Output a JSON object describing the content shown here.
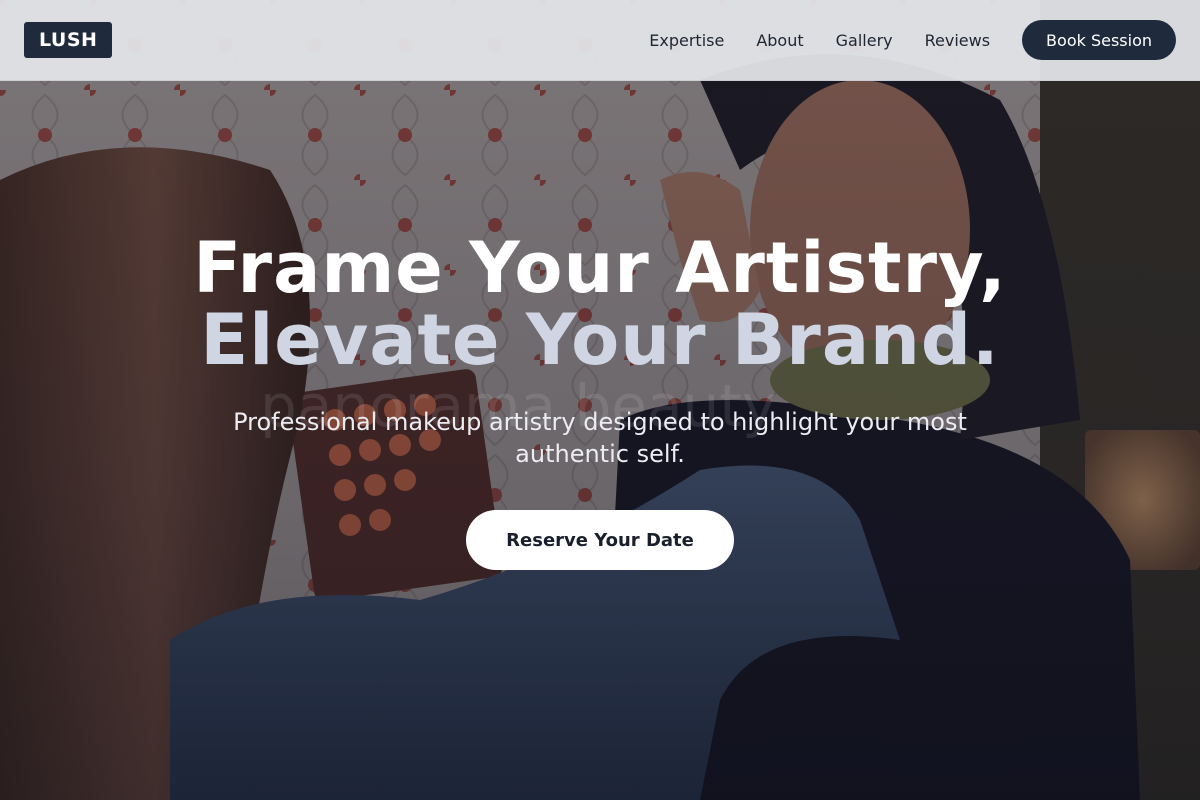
{
  "brand": {
    "logo_text": "LUSH"
  },
  "nav": {
    "links": [
      "Expertise",
      "About",
      "Gallery",
      "Reviews"
    ],
    "book_label": "Book Session"
  },
  "hero": {
    "headline_line1": "Frame Your Artistry,",
    "headline_line2": "Elevate Your Brand.",
    "subtitle": "Professional makeup artistry designed to highlight your most authentic self.",
    "cta_label": "Reserve Your Date",
    "watermark_text": "panorama beauty",
    "background_image": "makeup-artist-applying-bridal-makeup-photo"
  },
  "colors": {
    "navy": "#1f2a3d",
    "nav_bg": "#e2e4e8",
    "headline_white": "#ffffff",
    "headline_muted": "#cfd5e3",
    "cta_bg": "#ffffff"
  }
}
